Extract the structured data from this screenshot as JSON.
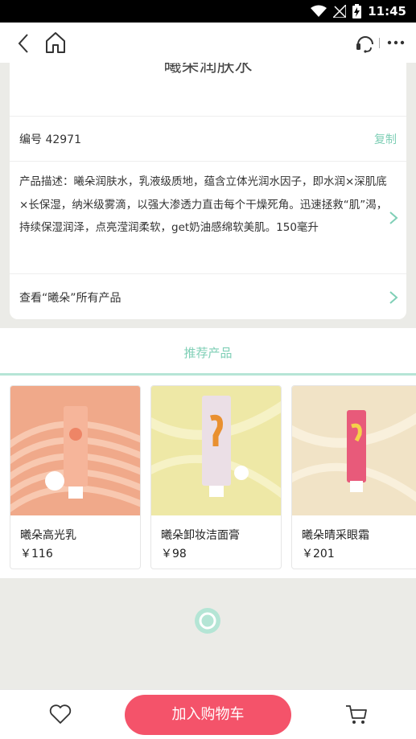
{
  "status_bar": {
    "time": "11:45"
  },
  "nav": {
    "back_icon": "chevron-left-icon",
    "home_icon": "home-icon",
    "service_icon": "headset-icon",
    "more_icon": "more-horizontal-icon"
  },
  "product": {
    "title": "曦朵润肤水",
    "code": "编号 42971",
    "copy_label": "复制",
    "description": "产品描述：曦朵润肤水，乳液级质地，蕴含立体光润水因子，即水润×深肌底×长保湿，纳米级雾滴，以强大渗透力直击每个干燥死角。迅速拯救“肌”渴，持续保湿润泽，点亮滢润柔软，get奶油感绵软美肌。150毫升",
    "view_all": "查看“曦朵”所有产品"
  },
  "recommend": {
    "title": "推荐产品",
    "items": [
      {
        "name": "曦朵高光乳",
        "price": "￥116"
      },
      {
        "name": "曦朵卸妆洁面膏",
        "price": "￥98"
      },
      {
        "name": "曦朵晴采眼霜",
        "price": "￥201"
      }
    ]
  },
  "bottom": {
    "favorite_icon": "heart-icon",
    "add_to_cart": "加入购物车",
    "cart_icon": "shopping-cart-icon"
  },
  "colors": {
    "accent": "#7fcfb6",
    "cart_button": "#f4536a",
    "page_bg": "#ebebe7"
  }
}
